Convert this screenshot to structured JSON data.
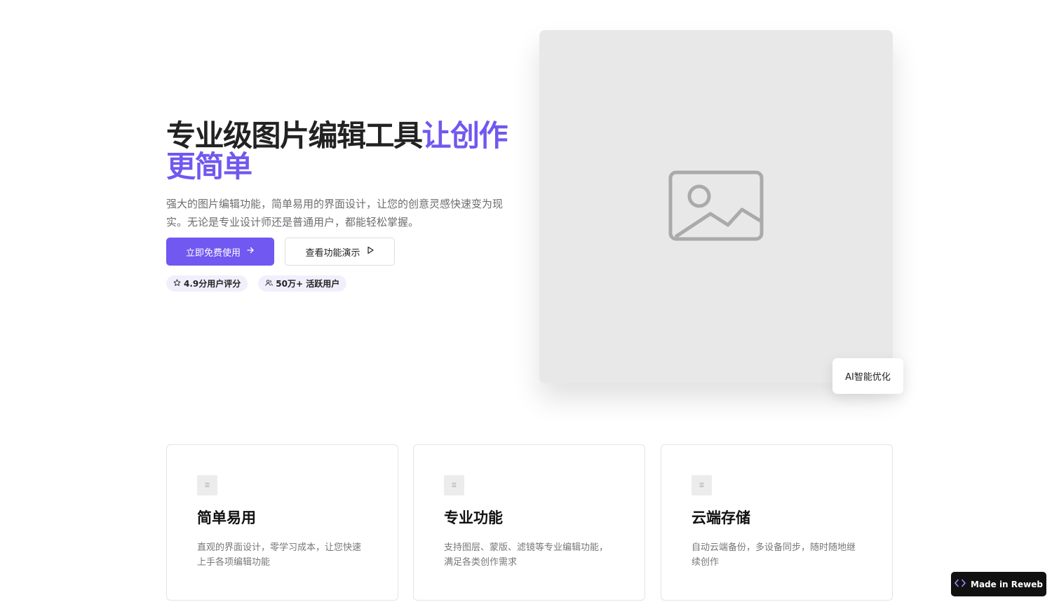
{
  "hero": {
    "title_main": "专业级图片编辑工具",
    "title_accent": "让创作更简单",
    "description": "强大的图片编辑功能，简单易用的界面设计，让您的创意灵感快速变为现实。无论是专业设计师还是普通用户，都能轻松掌握。",
    "primary_button": "立即免费使用",
    "secondary_button": "查看功能演示",
    "badges": [
      "4.9分用户评分",
      "50万+ 活跃用户"
    ]
  },
  "preview": {
    "ai_chip": "AI智能优化"
  },
  "features": [
    {
      "title": "简单易用",
      "desc": "直观的界面设计，零学习成本，让您快速上手各项编辑功能"
    },
    {
      "title": "专业功能",
      "desc": "支持图层、蒙版、滤镜等专业编辑功能，满足各类创作需求"
    },
    {
      "title": "云端存储",
      "desc": "自动云端备份，多设备同步，随时随地继续创作"
    }
  ],
  "footer_badge": "Made in Reweb",
  "colors": {
    "accent": "#7058f0",
    "placeholder": "#e8e8e8"
  }
}
